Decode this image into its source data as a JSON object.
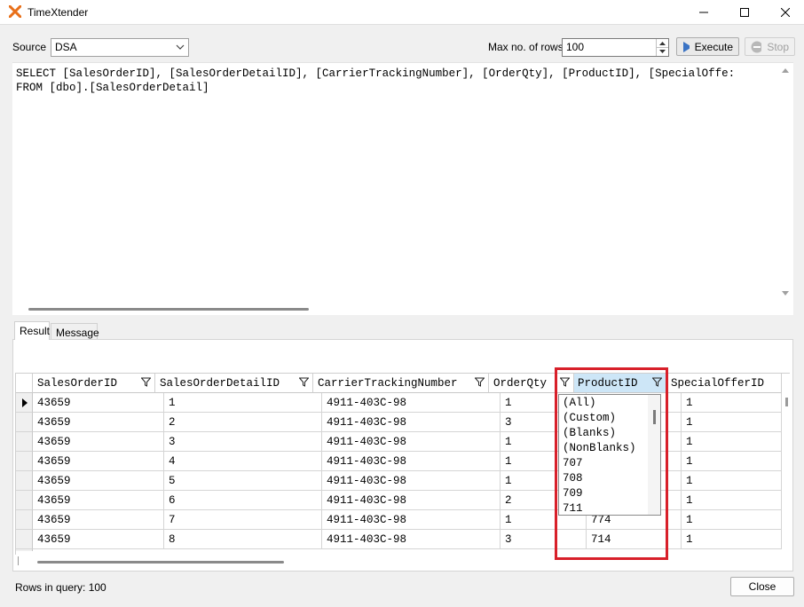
{
  "window": {
    "title": "TimeXtender",
    "accent": "#e8701a"
  },
  "toolbar": {
    "source_label": "Source",
    "source_value": "DSA",
    "max_rows_label": "Max no. of rows",
    "max_rows_value": "100",
    "execute_label": "Execute",
    "stop_label": "Stop"
  },
  "sql": {
    "line1": "SELECT [SalesOrderID], [SalesOrderDetailID], [CarrierTrackingNumber], [OrderQty], [ProductID], [SpecialOffe:",
    "line2": "FROM [dbo].[SalesOrderDetail]"
  },
  "tabs": [
    {
      "label": "Result"
    },
    {
      "label": "Message"
    }
  ],
  "grid": {
    "columns": [
      "SalesOrderID",
      "SalesOrderDetailID",
      "CarrierTrackingNumber",
      "OrderQty",
      "ProductID",
      "SpecialOfferID"
    ],
    "rows": [
      [
        "43659",
        "1",
        "4911-403C-98",
        "1",
        "",
        "1"
      ],
      [
        "43659",
        "2",
        "4911-403C-98",
        "3",
        "",
        "1"
      ],
      [
        "43659",
        "3",
        "4911-403C-98",
        "1",
        "",
        "1"
      ],
      [
        "43659",
        "4",
        "4911-403C-98",
        "1",
        "",
        "1"
      ],
      [
        "43659",
        "5",
        "4911-403C-98",
        "1",
        "",
        "1"
      ],
      [
        "43659",
        "6",
        "4911-403C-98",
        "2",
        "",
        "1"
      ],
      [
        "43659",
        "7",
        "4911-403C-98",
        "1",
        "774",
        "1"
      ],
      [
        "43659",
        "8",
        "4911-403C-98",
        "3",
        "714",
        "1"
      ]
    ]
  },
  "filter_dropdown": {
    "items": [
      "(All)",
      "(Custom)",
      "(Blanks)",
      "(NonBlanks)",
      "707",
      "708",
      "709",
      "711"
    ]
  },
  "highlight_color": "#d8202a",
  "status": {
    "rows_text": "Rows in query: 100"
  },
  "footer": {
    "close_label": "Close"
  }
}
